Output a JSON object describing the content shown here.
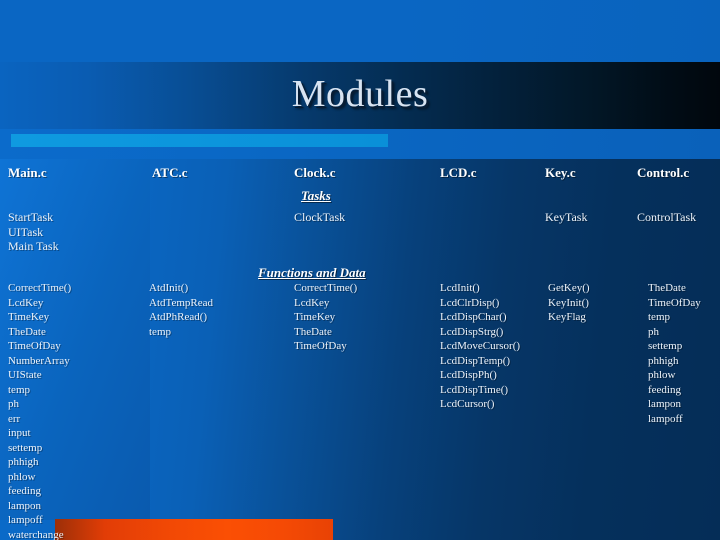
{
  "slide": {
    "title": "Modules",
    "tasks_heading": "Tasks",
    "functions_heading": "Functions and Data",
    "accent_color": "#0c96dd",
    "orange_color": "#f24905",
    "background_color": "#0a66c2",
    "title_color": "#d8e4f2"
  },
  "columns": [
    {
      "header": "Main.c",
      "tasks": [
        "StartTask",
        "UITask",
        "Main Task"
      ],
      "functions": [
        "CorrectTime()",
        "LcdKey",
        "TimeKey",
        "TheDate",
        "TimeOfDay",
        "NumberArray",
        "UIState",
        "temp",
        "ph",
        "err",
        "input",
        "settemp",
        "phhigh",
        "phlow",
        "feeding",
        "lampon",
        "lampoff",
        "waterchange"
      ]
    },
    {
      "header": "ATC.c",
      "tasks": [],
      "functions": [
        "AtdInit()",
        "AtdTempRead",
        "AtdPhRead()",
        "temp"
      ]
    },
    {
      "header": "Clock.c",
      "tasks": [
        "ClockTask"
      ],
      "functions": [
        "CorrectTime()",
        "LcdKey",
        "TimeKey",
        "TheDate",
        "TimeOfDay"
      ]
    },
    {
      "header": "LCD.c",
      "tasks": [],
      "functions": [
        "LcdInit()",
        "LcdClrDisp()",
        "LcdDispChar()",
        "LcdDispStrg()",
        "LcdMoveCursor()",
        "LcdDispTemp()",
        "LcdDispPh()",
        "LcdDispTime()",
        "LcdCursor()"
      ]
    },
    {
      "header": "Key.c",
      "tasks": [
        "KeyTask"
      ],
      "functions": [
        "GetKey()",
        "KeyInit()",
        "KeyFlag"
      ]
    },
    {
      "header": "Control.c",
      "tasks": [
        "ControlTask"
      ],
      "functions": [
        "TheDate",
        "TimeOfDay",
        "temp",
        "ph",
        "settemp",
        "phhigh",
        "phlow",
        "feeding",
        "lampon",
        "lampoff"
      ]
    }
  ]
}
